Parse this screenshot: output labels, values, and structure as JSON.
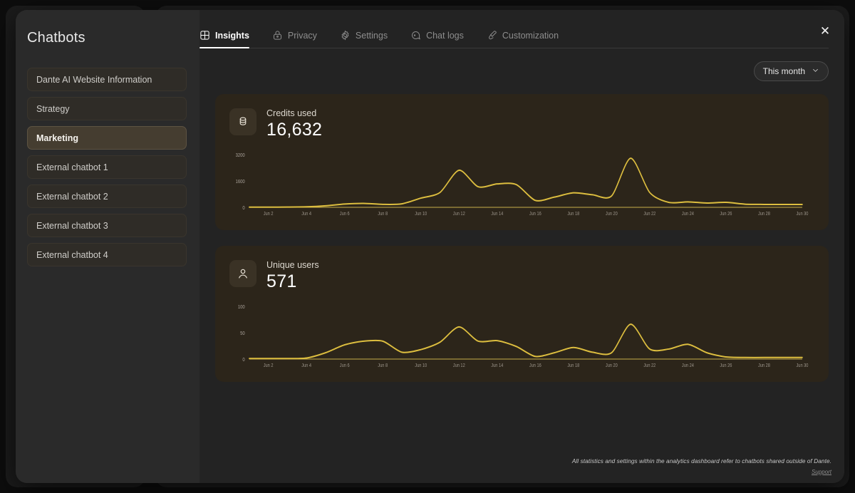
{
  "window": {
    "close_label": "✕"
  },
  "sidebar": {
    "title": "Chatbots",
    "items": [
      {
        "label": "Dante AI Website Information",
        "active": false
      },
      {
        "label": "Strategy",
        "active": false
      },
      {
        "label": "Marketing",
        "active": true
      },
      {
        "label": "External chatbot 1",
        "active": false
      },
      {
        "label": "External chatbot 2",
        "active": false
      },
      {
        "label": "External chatbot 3",
        "active": false
      },
      {
        "label": "External chatbot 4",
        "active": false
      }
    ]
  },
  "tabs": [
    {
      "label": "Insights",
      "icon": "layout-grid-icon",
      "active": true
    },
    {
      "label": "Privacy",
      "icon": "lock-icon",
      "active": false
    },
    {
      "label": "Settings",
      "icon": "gear-icon",
      "active": false
    },
    {
      "label": "Chat logs",
      "icon": "chat-bubble-icon",
      "active": false
    },
    {
      "label": "Customization",
      "icon": "brush-icon",
      "active": false
    }
  ],
  "range_selector": {
    "value": "This month",
    "chevron": "chevron-down-icon"
  },
  "cards": [
    {
      "label": "Credits used",
      "value": "16,632",
      "icon": "coin-stack-icon"
    },
    {
      "label": "Unique users",
      "value": "571",
      "icon": "user-icon"
    }
  ],
  "footer": {
    "note": "All statistics and settings within the analytics dashboard refer to chatbots shared outside of Dante.",
    "support_label": "Support"
  },
  "colors": {
    "accent_line": "#ddbe3f",
    "card_bg": "#2c251a",
    "active_item_bg": "#453d30",
    "modal_bg": "#2a2a2a",
    "main_bg": "#232323"
  },
  "chart_data": [
    {
      "type": "line",
      "title": "Credits used",
      "xlabel": "",
      "ylabel": "",
      "ylim": [
        0,
        3200
      ],
      "yticks": [
        0,
        1600,
        3200
      ],
      "grid": false,
      "legend": "none",
      "x": [
        "Jun 1",
        "Jun 2",
        "Jun 3",
        "Jun 4",
        "Jun 5",
        "Jun 6",
        "Jun 7",
        "Jun 8",
        "Jun 9",
        "Jun 10",
        "Jun 11",
        "Jun 12",
        "Jun 13",
        "Jun 14",
        "Jun 15",
        "Jun 16",
        "Jun 17",
        "Jun 18",
        "Jun 19",
        "Jun 20",
        "Jun 21",
        "Jun 22",
        "Jun 23",
        "Jun 24",
        "Jun 25",
        "Jun 26",
        "Jun 27",
        "Jun 28",
        "Jun 29",
        "Jun 30"
      ],
      "tick_labels": [
        "Jun 2",
        "Jun 4",
        "Jun 6",
        "Jun 8",
        "Jun 10",
        "Jun 12",
        "Jun 14",
        "Jun 16",
        "Jun 18",
        "Jun 20",
        "Jun 22",
        "Jun 24",
        "Jun 26",
        "Jun 28",
        "Jun 30"
      ],
      "values": [
        10,
        12,
        15,
        30,
        90,
        200,
        240,
        180,
        210,
        560,
        900,
        2250,
        1250,
        1420,
        1380,
        420,
        620,
        880,
        760,
        690,
        2980,
        900,
        300,
        330,
        260,
        300,
        190,
        175,
        175,
        175
      ],
      "series": [
        {
          "name": "Credits used",
          "values": [
            10,
            12,
            15,
            30,
            90,
            200,
            240,
            180,
            210,
            560,
            900,
            2250,
            1250,
            1420,
            1380,
            420,
            620,
            880,
            760,
            690,
            2980,
            900,
            300,
            330,
            260,
            300,
            190,
            175,
            175,
            175
          ]
        }
      ]
    },
    {
      "type": "line",
      "title": "Unique users",
      "xlabel": "",
      "ylabel": "",
      "ylim": [
        0,
        100
      ],
      "yticks": [
        0,
        50,
        100
      ],
      "grid": false,
      "legend": "none",
      "x": [
        "Jun 1",
        "Jun 2",
        "Jun 3",
        "Jun 4",
        "Jun 5",
        "Jun 6",
        "Jun 7",
        "Jun 8",
        "Jun 9",
        "Jun 10",
        "Jun 11",
        "Jun 12",
        "Jun 13",
        "Jun 14",
        "Jun 15",
        "Jun 16",
        "Jun 17",
        "Jun 18",
        "Jun 19",
        "Jun 20",
        "Jun 21",
        "Jun 22",
        "Jun 23",
        "Jun 24",
        "Jun 25",
        "Jun 26",
        "Jun 27",
        "Jun 28",
        "Jun 29",
        "Jun 30"
      ],
      "tick_labels": [
        "Jun 2",
        "Jun 4",
        "Jun 6",
        "Jun 8",
        "Jun 10",
        "Jun 12",
        "Jun 14",
        "Jun 16",
        "Jun 18",
        "Jun 20",
        "Jun 22",
        "Jun 24",
        "Jun 26",
        "Jun 28",
        "Jun 30"
      ],
      "values": [
        1,
        1,
        1,
        2,
        12,
        27,
        34,
        34,
        13,
        18,
        32,
        61,
        34,
        35,
        24,
        5,
        12,
        22,
        13,
        12,
        66,
        19,
        19,
        28,
        12,
        4,
        3,
        3,
        3,
        3
      ],
      "series": [
        {
          "name": "Unique users",
          "values": [
            1,
            1,
            1,
            2,
            12,
            27,
            34,
            34,
            13,
            18,
            32,
            61,
            34,
            35,
            24,
            5,
            12,
            22,
            13,
            12,
            66,
            19,
            19,
            28,
            12,
            4,
            3,
            3,
            3,
            3
          ]
        }
      ]
    }
  ]
}
